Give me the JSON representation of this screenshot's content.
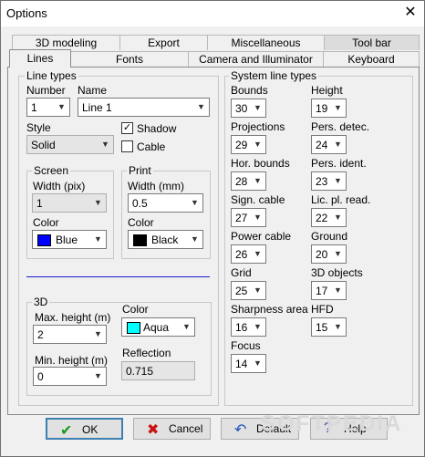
{
  "window": {
    "title": "Options",
    "close": "✕"
  },
  "tabs_row1": [
    {
      "label": "3D modeling"
    },
    {
      "label": "Export"
    },
    {
      "label": "Miscellaneous"
    },
    {
      "label": "Tool bar"
    }
  ],
  "tabs_row2": [
    {
      "label": "Lines"
    },
    {
      "label": "Fonts"
    },
    {
      "label": "Camera and Illuminator"
    },
    {
      "label": "Keyboard"
    }
  ],
  "line_types": {
    "group_title": "Line types",
    "number_label": "Number",
    "number_value": "1",
    "name_label": "Name",
    "name_value": "Line 1",
    "style_label": "Style",
    "style_value": "Solid",
    "shadow_label": "Shadow",
    "shadow_checked": "✓",
    "cable_label": "Cable",
    "screen": {
      "title": "Screen",
      "width_label": "Width (pix)",
      "width_value": "1",
      "color_label": "Color",
      "color_value": "Blue",
      "color_hex": "#0000ff"
    },
    "print": {
      "title": "Print",
      "width_label": "Width (mm)",
      "width_value": "0.5",
      "color_label": "Color",
      "color_value": "Black",
      "color_hex": "#000000"
    },
    "three_d": {
      "title": "3D",
      "max_height_label": "Max. height (m)",
      "max_height_value": "2",
      "min_height_label": "Min. height (m)",
      "min_height_value": "0",
      "color_label": "Color",
      "color_value": "Aqua",
      "color_hex": "#00ffff",
      "reflection_label": "Reflection",
      "reflection_value": "0.715"
    }
  },
  "system_line_types": {
    "group_title": "System line types",
    "left": [
      {
        "label": "Bounds",
        "value": "30"
      },
      {
        "label": "Projections",
        "value": "29"
      },
      {
        "label": "Hor. bounds",
        "value": "28"
      },
      {
        "label": "Sign. cable",
        "value": "27"
      },
      {
        "label": "Power cable",
        "value": "26"
      },
      {
        "label": "Grid",
        "value": "25"
      },
      {
        "label": "Sharpness area",
        "value": "16"
      },
      {
        "label": "Focus",
        "value": "14"
      }
    ],
    "right": [
      {
        "label": "Height",
        "value": "19"
      },
      {
        "label": "Pers. detec.",
        "value": "24"
      },
      {
        "label": "Pers. ident.",
        "value": "23"
      },
      {
        "label": "Lic. pl. read.",
        "value": "22"
      },
      {
        "label": "Ground",
        "value": "20"
      },
      {
        "label": "3D objects",
        "value": "17"
      },
      {
        "label": "HFD",
        "value": "15"
      }
    ]
  },
  "buttons": {
    "ok": "OK",
    "cancel": "Cancel",
    "default": "Default",
    "help": "Help"
  },
  "watermark": "SOFTPEDIA"
}
